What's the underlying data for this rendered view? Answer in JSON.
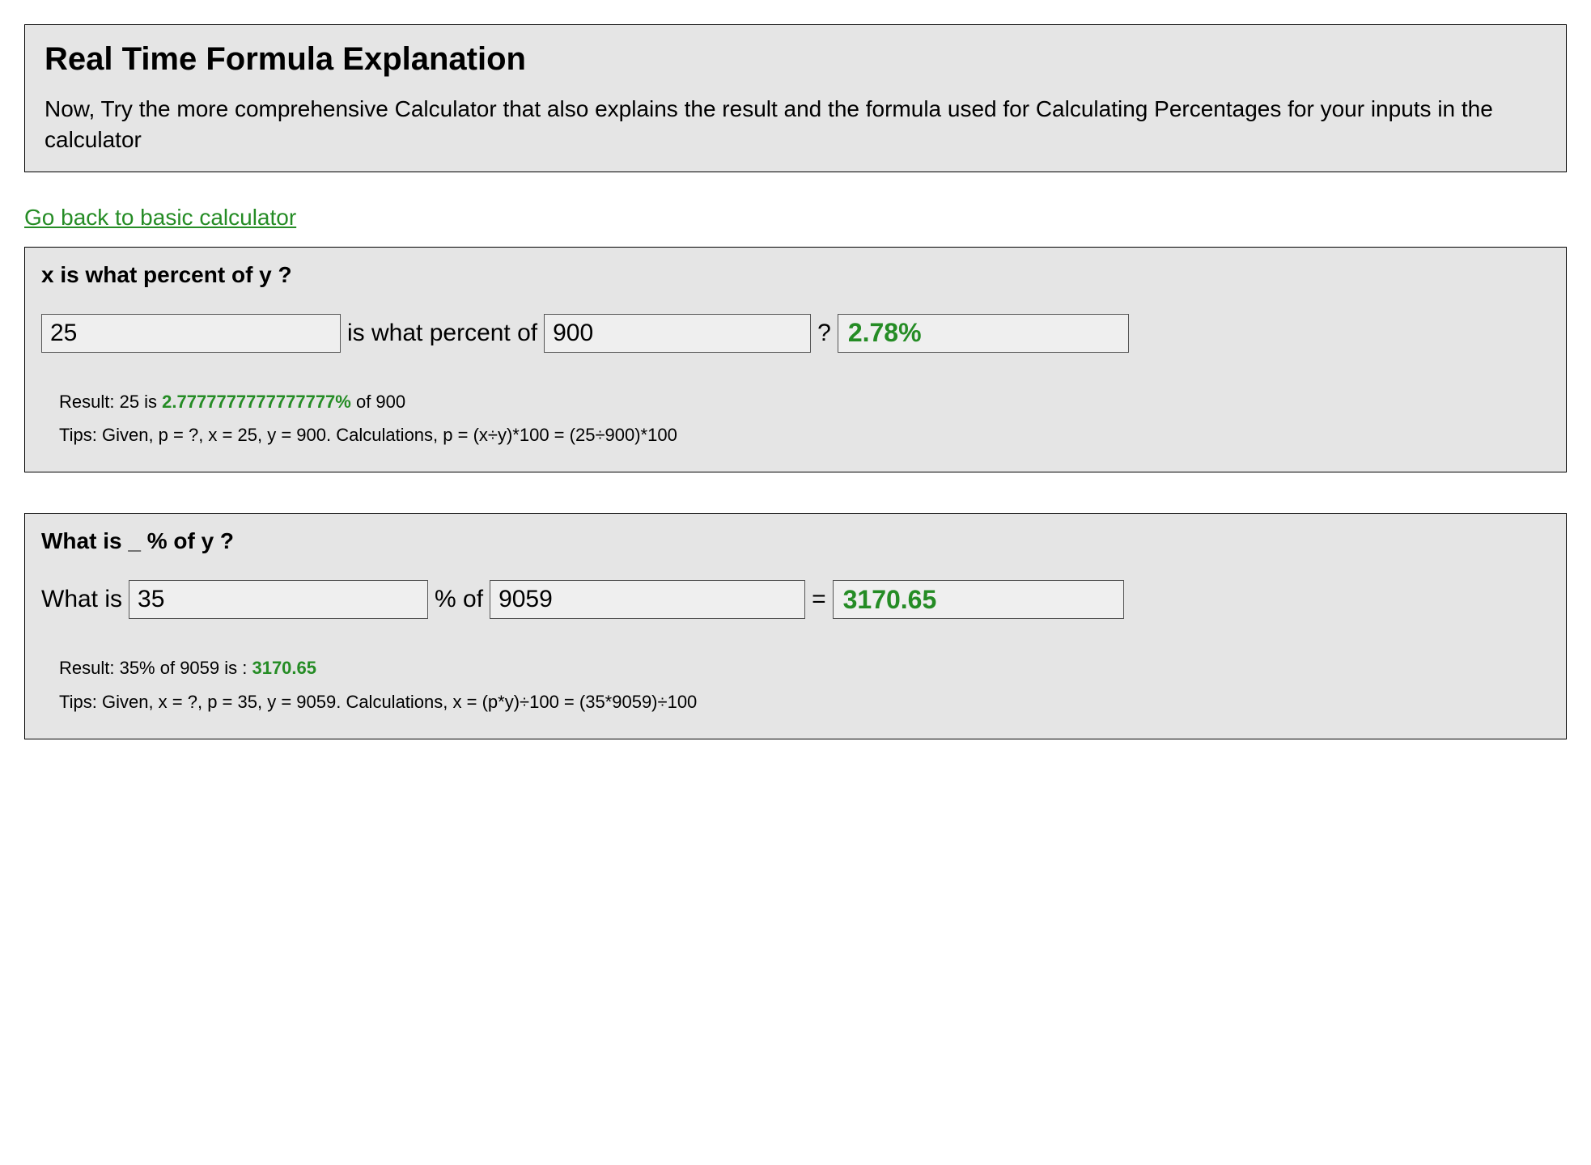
{
  "header": {
    "title": "Real Time Formula Explanation",
    "subtitle": "Now, Try the more comprehensive Calculator that also explains the result and the formula used for Calculating Percentages for your inputs in the calculator"
  },
  "backLink": "Go back to basic calculator",
  "calc1": {
    "title": "x is what percent of y ?",
    "xValue": "25",
    "midText": "is what percent of",
    "yValue": "900",
    "qmark": "?",
    "result": "2.78%",
    "resultLinePrefix": "Result: 25 is ",
    "resultLineGreen": "2.7777777777777777%",
    "resultLineSuffix": " of 900",
    "tipsLine": "Tips: Given, p = ?, x = 25, y = 900. Calculations, p = (x÷y)*100 = (25÷900)*100"
  },
  "calc2": {
    "title": "What is _ % of y ?",
    "prefix": "What is",
    "pValue": "35",
    "midText": "% of",
    "yValue": "9059",
    "equals": "=",
    "result": "3170.65",
    "resultLinePrefix": "Result: 35% of 9059 is : ",
    "resultLineGreen": "3170.65",
    "tipsLine": "Tips: Given, x = ?, p = 35, y = 9059. Calculations, x = (p*y)÷100 = (35*9059)÷100"
  }
}
